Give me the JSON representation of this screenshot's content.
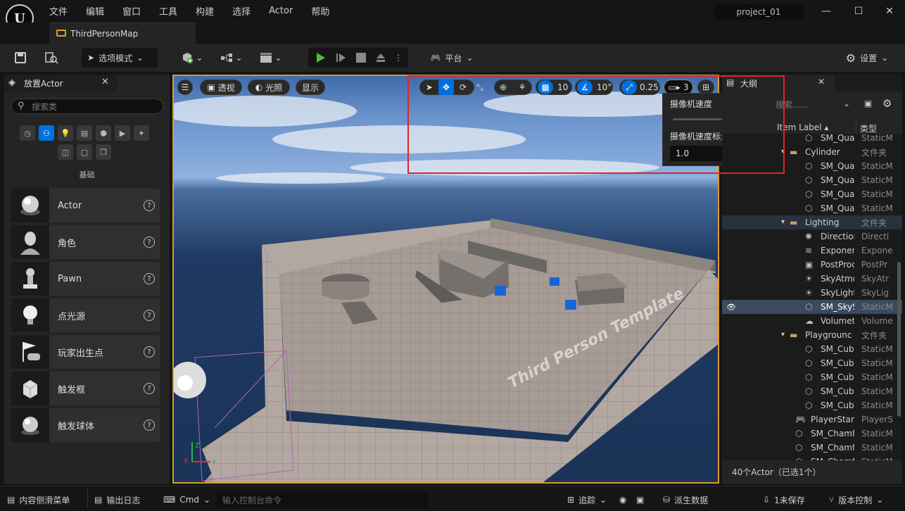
{
  "window": {
    "project": "project_01"
  },
  "menu": [
    "文件",
    "编辑",
    "窗口",
    "工具",
    "构建",
    "选择",
    "Actor",
    "帮助"
  ],
  "tab": {
    "label": "ThirdPersonMap"
  },
  "toolbar": {
    "mode_label": "选项模式",
    "platform_label": "平台",
    "settings_label": "设置"
  },
  "left_panel": {
    "title": "放置Actor",
    "search_placeholder": "搜索类",
    "section_label": "基础",
    "items": [
      "Actor",
      "角色",
      "Pawn",
      "点光源",
      "玩家出生点",
      "触发框",
      "触发球体"
    ]
  },
  "viewport": {
    "perspective_label": "透视",
    "lighting_label": "光照",
    "show_label": "显示",
    "grid_snap": "10",
    "rotation_snap": "10°",
    "scale_snap": "0.25",
    "camera_speed": "3",
    "watermark": "Third Person Template"
  },
  "camera_popup": {
    "speed_label": "摄像机速度",
    "speed_value": "3",
    "speed_level": 0.5,
    "scalar_label": "摄像机速度标量",
    "scalar_value": "1.0"
  },
  "outliner": {
    "title": "大纲",
    "search_placeholder": "搜索......",
    "col_label": "Item Label",
    "col_type": "类型",
    "rows": [
      {
        "name": "SM_Quar",
        "type": "StaticM",
        "kind": "mesh",
        "depth": 2
      },
      {
        "name": "Cylinder",
        "type": "文件夹",
        "kind": "folder",
        "depth": 1
      },
      {
        "name": "SM_Quar",
        "type": "StaticM",
        "kind": "mesh",
        "depth": 2
      },
      {
        "name": "SM_Quar",
        "type": "StaticM",
        "kind": "mesh",
        "depth": 2
      },
      {
        "name": "SM_Quar",
        "type": "StaticM",
        "kind": "mesh",
        "depth": 2
      },
      {
        "name": "SM_Quar",
        "type": "StaticM",
        "kind": "mesh",
        "depth": 2
      },
      {
        "name": "Lighting",
        "type": "文件夹",
        "kind": "folder",
        "depth": 1
      },
      {
        "name": "Direction",
        "type": "Directi",
        "kind": "light",
        "depth": 2
      },
      {
        "name": "Exponen",
        "type": "Expone",
        "kind": "fog",
        "depth": 2
      },
      {
        "name": "PostProc",
        "type": "PostPr",
        "kind": "post",
        "depth": 2
      },
      {
        "name": "SkyAtmo",
        "type": "SkyAtr",
        "kind": "sky",
        "depth": 2
      },
      {
        "name": "SkyLight",
        "type": "SkyLig",
        "kind": "sky",
        "depth": 2
      },
      {
        "name": "SM_SkyS",
        "type": "StaticM",
        "kind": "mesh",
        "depth": 2
      },
      {
        "name": "Volumetr",
        "type": "Volume",
        "kind": "cloud",
        "depth": 2
      },
      {
        "name": "Playgrounc",
        "type": "文件夹",
        "kind": "folder",
        "depth": 1
      },
      {
        "name": "SM_Cube",
        "type": "StaticM",
        "kind": "mesh",
        "depth": 2
      },
      {
        "name": "SM_Cube",
        "type": "StaticM",
        "kind": "mesh",
        "depth": 2
      },
      {
        "name": "SM_Cube",
        "type": "StaticM",
        "kind": "mesh",
        "depth": 2
      },
      {
        "name": "SM_Cube",
        "type": "StaticM",
        "kind": "mesh",
        "depth": 2
      },
      {
        "name": "SM_Cube",
        "type": "StaticM",
        "kind": "mesh",
        "depth": 2
      },
      {
        "name": "PlayerStar",
        "type": "PlayerS",
        "kind": "player",
        "depth": 0
      },
      {
        "name": "SM_Chamf",
        "type": "StaticM",
        "kind": "mesh",
        "depth": 0
      },
      {
        "name": "SM_Chamf",
        "type": "StaticM",
        "kind": "mesh",
        "depth": 0
      },
      {
        "name": "SM_Chamf",
        "type": "StaticM",
        "kind": "mesh",
        "depth": 0
      }
    ],
    "footer": "40个Actor（已选1个）"
  },
  "statusbar": {
    "content_drawer": "内容侧滑菜单",
    "output_log": "输出日志",
    "cmd": "Cmd",
    "cmd_placeholder": "输入控制台命令",
    "trace": "追踪",
    "derived_data": "派生数据",
    "unsaved": "1未保存",
    "source_control": "版本控制"
  },
  "colors": {
    "accent": "#0070e0",
    "selection": "#d99a2b",
    "highlight_box": "#e02424",
    "play_green": "#4fbc3a"
  }
}
